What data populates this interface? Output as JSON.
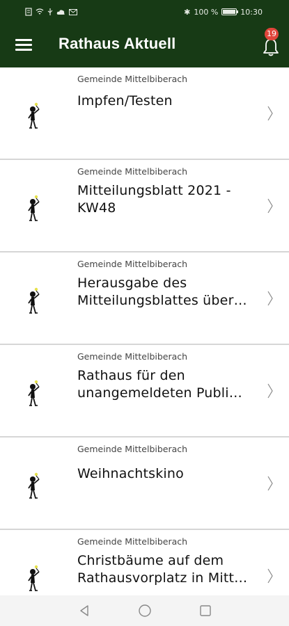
{
  "status_bar": {
    "bluetooth": "✱",
    "battery_percent": "100 %",
    "time": "10:30",
    "battery_level": 1.0
  },
  "app_bar": {
    "title": "Rathaus Aktuell",
    "notification_count": "19",
    "accent_color": "#173a15",
    "badge_color": "#e0463c"
  },
  "items": [
    {
      "source": "Gemeinde Mittelbiberach",
      "title_lines": [
        "Impfen/Testen"
      ]
    },
    {
      "source": "Gemeinde Mittelbiberach",
      "title_lines": [
        "Mitteilungsblatt 2021 -",
        "KW48"
      ]
    },
    {
      "source": "Gemeinde Mittelbiberach",
      "title_lines": [
        "Herausgabe des",
        "Mitteilungsblattes über…"
      ]
    },
    {
      "source": "Gemeinde Mittelbiberach",
      "title_lines": [
        "Rathaus für den",
        "unangemeldeten Publi…"
      ]
    },
    {
      "source": "Gemeinde Mittelbiberach",
      "title_lines": [
        "Weihnachtskino"
      ]
    },
    {
      "source": "Gemeinde Mittelbiberach",
      "title_lines": [
        "Christbäume auf dem",
        "Rathausvorplatz in Mitt…"
      ]
    }
  ],
  "icons": {
    "menu": "menu-icon",
    "bell": "bell-icon",
    "thumbnail": "mascot-thumbnail-icon",
    "chevron": "chevron-right-icon",
    "nav_back": "back-triangle-icon",
    "nav_home": "home-circle-icon",
    "nav_recents": "recents-square-icon"
  }
}
